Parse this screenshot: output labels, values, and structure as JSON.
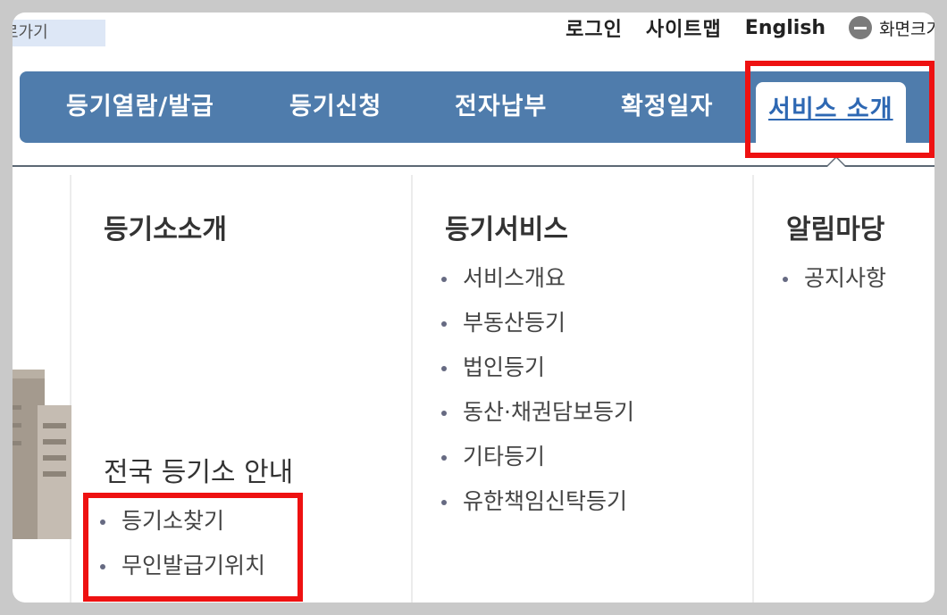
{
  "skip_link": "로가기",
  "util_nav": {
    "login": "로그인",
    "sitemap": "사이트맵",
    "english": "English",
    "zoom_label": "화면크기"
  },
  "gnb": {
    "items": [
      {
        "label": "등기열람/발급"
      },
      {
        "label": "등기신청"
      },
      {
        "label": "전자납부"
      },
      {
        "label": "확정일자"
      },
      {
        "label": "서비스 소개",
        "active": true
      }
    ]
  },
  "submenu": {
    "col1": {
      "title": "등기소소개",
      "section2_title": "전국 등기소 안내",
      "items": [
        "등기소찾기",
        "무인발급기위치"
      ]
    },
    "col2": {
      "title": "등기서비스",
      "items": [
        "서비스개요",
        "부동산등기",
        "법인등기",
        "동산·채권담보등기",
        "기타등기",
        "유한책임신탁등기"
      ]
    },
    "col3": {
      "title": "알림마당",
      "items": [
        "공지사항"
      ]
    }
  },
  "colors": {
    "nav_bg": "#4f7cac",
    "active_text": "#2e68b3",
    "highlight": "#ee1111"
  }
}
